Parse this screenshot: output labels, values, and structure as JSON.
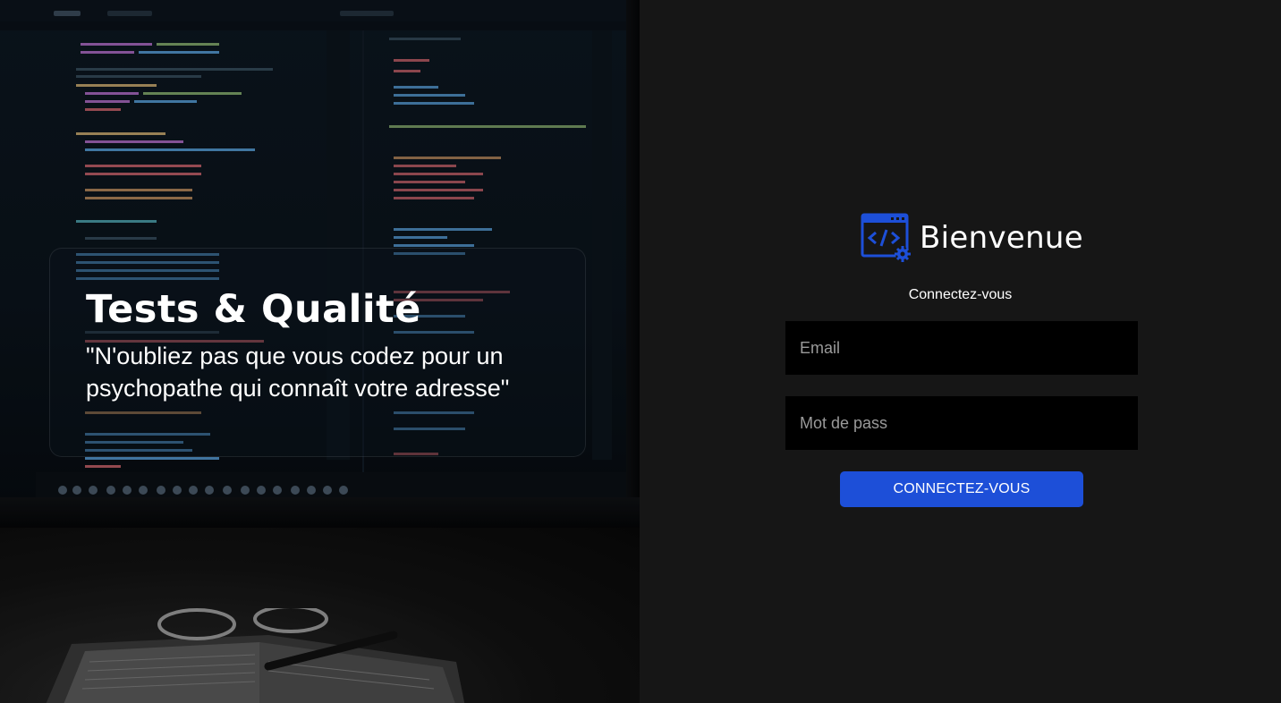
{
  "hero": {
    "title": "Tests & Qualité",
    "quote": "\"N'oubliez pas que vous codez pour un psychopathe qui connaît votre adresse\""
  },
  "login": {
    "brand_title": "Bienvenue",
    "brand_icon": "code-window-gear-icon",
    "subtitle": "Connectez-vous",
    "email_placeholder": "Email",
    "password_placeholder": "Mot de pass",
    "submit_label": "CONNECTEZ-VOUS"
  },
  "colors": {
    "accent": "#1d4fd8",
    "panel_bg": "#161616",
    "field_bg": "#000000"
  }
}
